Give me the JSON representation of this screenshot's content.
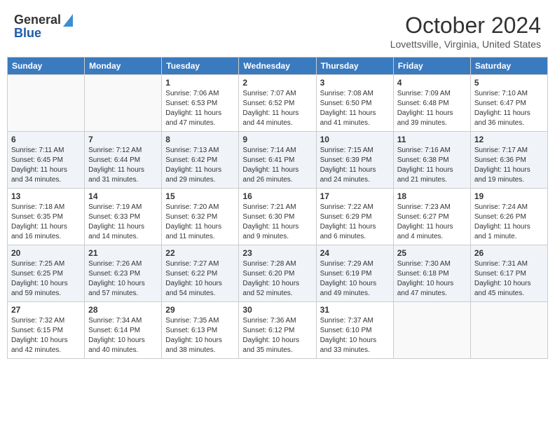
{
  "header": {
    "logo_line1": "General",
    "logo_line2": "Blue",
    "title": "October 2024",
    "subtitle": "Lovettsville, Virginia, United States"
  },
  "days_of_week": [
    "Sunday",
    "Monday",
    "Tuesday",
    "Wednesday",
    "Thursday",
    "Friday",
    "Saturday"
  ],
  "weeks": [
    [
      {
        "day": "",
        "info": ""
      },
      {
        "day": "",
        "info": ""
      },
      {
        "day": "1",
        "info": "Sunrise: 7:06 AM\nSunset: 6:53 PM\nDaylight: 11 hours and 47 minutes."
      },
      {
        "day": "2",
        "info": "Sunrise: 7:07 AM\nSunset: 6:52 PM\nDaylight: 11 hours and 44 minutes."
      },
      {
        "day": "3",
        "info": "Sunrise: 7:08 AM\nSunset: 6:50 PM\nDaylight: 11 hours and 41 minutes."
      },
      {
        "day": "4",
        "info": "Sunrise: 7:09 AM\nSunset: 6:48 PM\nDaylight: 11 hours and 39 minutes."
      },
      {
        "day": "5",
        "info": "Sunrise: 7:10 AM\nSunset: 6:47 PM\nDaylight: 11 hours and 36 minutes."
      }
    ],
    [
      {
        "day": "6",
        "info": "Sunrise: 7:11 AM\nSunset: 6:45 PM\nDaylight: 11 hours and 34 minutes."
      },
      {
        "day": "7",
        "info": "Sunrise: 7:12 AM\nSunset: 6:44 PM\nDaylight: 11 hours and 31 minutes."
      },
      {
        "day": "8",
        "info": "Sunrise: 7:13 AM\nSunset: 6:42 PM\nDaylight: 11 hours and 29 minutes."
      },
      {
        "day": "9",
        "info": "Sunrise: 7:14 AM\nSunset: 6:41 PM\nDaylight: 11 hours and 26 minutes."
      },
      {
        "day": "10",
        "info": "Sunrise: 7:15 AM\nSunset: 6:39 PM\nDaylight: 11 hours and 24 minutes."
      },
      {
        "day": "11",
        "info": "Sunrise: 7:16 AM\nSunset: 6:38 PM\nDaylight: 11 hours and 21 minutes."
      },
      {
        "day": "12",
        "info": "Sunrise: 7:17 AM\nSunset: 6:36 PM\nDaylight: 11 hours and 19 minutes."
      }
    ],
    [
      {
        "day": "13",
        "info": "Sunrise: 7:18 AM\nSunset: 6:35 PM\nDaylight: 11 hours and 16 minutes."
      },
      {
        "day": "14",
        "info": "Sunrise: 7:19 AM\nSunset: 6:33 PM\nDaylight: 11 hours and 14 minutes."
      },
      {
        "day": "15",
        "info": "Sunrise: 7:20 AM\nSunset: 6:32 PM\nDaylight: 11 hours and 11 minutes."
      },
      {
        "day": "16",
        "info": "Sunrise: 7:21 AM\nSunset: 6:30 PM\nDaylight: 11 hours and 9 minutes."
      },
      {
        "day": "17",
        "info": "Sunrise: 7:22 AM\nSunset: 6:29 PM\nDaylight: 11 hours and 6 minutes."
      },
      {
        "day": "18",
        "info": "Sunrise: 7:23 AM\nSunset: 6:27 PM\nDaylight: 11 hours and 4 minutes."
      },
      {
        "day": "19",
        "info": "Sunrise: 7:24 AM\nSunset: 6:26 PM\nDaylight: 11 hours and 1 minute."
      }
    ],
    [
      {
        "day": "20",
        "info": "Sunrise: 7:25 AM\nSunset: 6:25 PM\nDaylight: 10 hours and 59 minutes."
      },
      {
        "day": "21",
        "info": "Sunrise: 7:26 AM\nSunset: 6:23 PM\nDaylight: 10 hours and 57 minutes."
      },
      {
        "day": "22",
        "info": "Sunrise: 7:27 AM\nSunset: 6:22 PM\nDaylight: 10 hours and 54 minutes."
      },
      {
        "day": "23",
        "info": "Sunrise: 7:28 AM\nSunset: 6:20 PM\nDaylight: 10 hours and 52 minutes."
      },
      {
        "day": "24",
        "info": "Sunrise: 7:29 AM\nSunset: 6:19 PM\nDaylight: 10 hours and 49 minutes."
      },
      {
        "day": "25",
        "info": "Sunrise: 7:30 AM\nSunset: 6:18 PM\nDaylight: 10 hours and 47 minutes."
      },
      {
        "day": "26",
        "info": "Sunrise: 7:31 AM\nSunset: 6:17 PM\nDaylight: 10 hours and 45 minutes."
      }
    ],
    [
      {
        "day": "27",
        "info": "Sunrise: 7:32 AM\nSunset: 6:15 PM\nDaylight: 10 hours and 42 minutes."
      },
      {
        "day": "28",
        "info": "Sunrise: 7:34 AM\nSunset: 6:14 PM\nDaylight: 10 hours and 40 minutes."
      },
      {
        "day": "29",
        "info": "Sunrise: 7:35 AM\nSunset: 6:13 PM\nDaylight: 10 hours and 38 minutes."
      },
      {
        "day": "30",
        "info": "Sunrise: 7:36 AM\nSunset: 6:12 PM\nDaylight: 10 hours and 35 minutes."
      },
      {
        "day": "31",
        "info": "Sunrise: 7:37 AM\nSunset: 6:10 PM\nDaylight: 10 hours and 33 minutes."
      },
      {
        "day": "",
        "info": ""
      },
      {
        "day": "",
        "info": ""
      }
    ]
  ]
}
